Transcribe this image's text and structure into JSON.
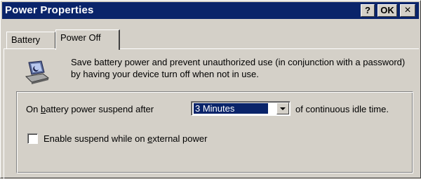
{
  "window": {
    "title": "Power Properties",
    "help_label": "?",
    "ok_label": "OK",
    "close_label": "×"
  },
  "tabs": [
    {
      "label": "Battery",
      "active": false
    },
    {
      "label": "Power Off",
      "active": true
    }
  ],
  "description": "Save battery power and prevent unauthorized use (in conjunction with a password) by having your device turn off when not in use.",
  "suspend": {
    "label_pre": "On ",
    "label_ul": "b",
    "label_post": "attery power suspend after",
    "selected_value": "3 Minutes",
    "suffix": "of continuous idle time."
  },
  "external_power": {
    "label_pre": "Enable suspend while on ",
    "label_ul": "e",
    "label_post": "xternal power",
    "checked": false
  },
  "colors": {
    "title_bg": "#0a246a",
    "face": "#d4d0c8",
    "selection": "#0a246a"
  }
}
